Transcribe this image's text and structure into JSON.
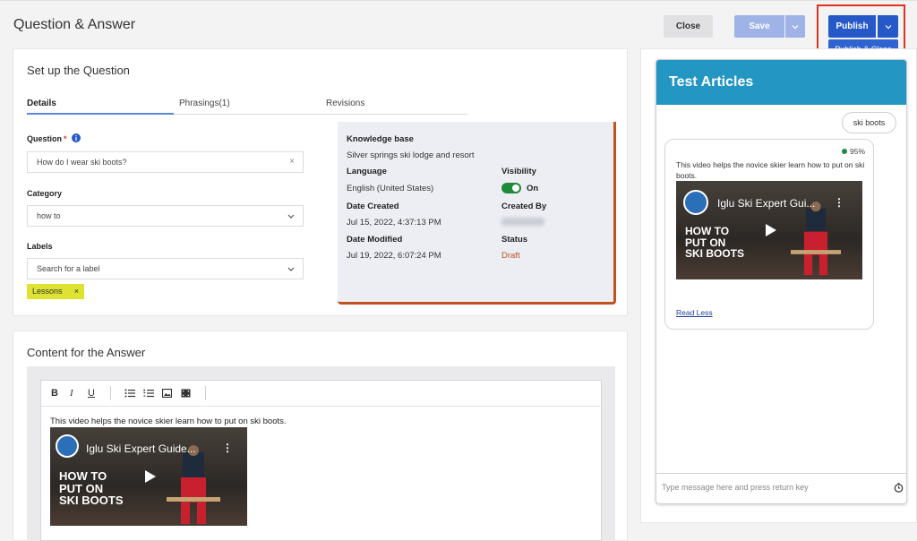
{
  "header": {
    "title": "Question & Answer",
    "close_label": "Close",
    "save_label": "Save",
    "publish_label": "Publish",
    "publish_close_label": "Publish & Close"
  },
  "setup": {
    "title": "Set up the Question",
    "tabs": [
      {
        "label": "Details",
        "active": true
      },
      {
        "label": "Phrasings(1)",
        "active": false
      },
      {
        "label": "Revisions",
        "active": false
      }
    ],
    "question_label": "Question",
    "question_required": "*",
    "question_value": "How do I wear ski boots?",
    "clear_glyph": "×",
    "category_label": "Category",
    "category_value": "how to",
    "labels_label": "Labels",
    "labels_placeholder": "Search for a label",
    "label_chips": [
      {
        "label": "Lessons",
        "remove": "×"
      }
    ]
  },
  "kb": {
    "kb_label": "Knowledge base",
    "kb_value": "Silver springs ski lodge and resort",
    "language_label": "Language",
    "language_value": "English (United States)",
    "visibility_label": "Visibility",
    "visibility_value": "On",
    "date_created_label": "Date Created",
    "date_created_value": "Jul 15, 2022, 4:37:13 PM",
    "created_by_label": "Created By",
    "date_modified_label": "Date Modified",
    "date_modified_value": "Jul 19, 2022, 6:07:24 PM",
    "status_label": "Status",
    "status_value": "Draft"
  },
  "answer": {
    "title": "Content for the Answer",
    "toolbar": {
      "bold": "B",
      "italic": "I",
      "underline": "U"
    },
    "body_text": "This video helps the novice skier learn how to put on ski boots.",
    "video_title": "Iglu Ski Expert Guide...",
    "video_lines": [
      "HOW TO",
      "PUT ON",
      "SKI BOOTS"
    ],
    "video_logo_text": "IGLU SKI",
    "video_menu": "⋮"
  },
  "chat": {
    "title": "Test Articles",
    "user_message": "ski boots",
    "score": "95%",
    "bot_text": "This video helps the novice skier learn how to put on ski boots.",
    "video_title": "Iglu Ski Expert Gui...",
    "video_lines": [
      "HOW TO",
      "PUT ON",
      "SKI BOOTS"
    ],
    "video_logo_text": "IGLU SKI",
    "video_menu": "⋮",
    "read_less": "Read Less",
    "input_placeholder": "Type message here and press return key"
  },
  "colors": {
    "primary": "#2659c7",
    "accent_header": "#2496c4",
    "highlight": "#e0301e",
    "draft": "#c0521e",
    "toggle_on": "#1e8a3a",
    "chip": "#dde330"
  },
  "icons": [
    "info-icon",
    "close-icon",
    "chevron-down-icon",
    "bullet-list-icon",
    "numbered-list-icon",
    "image-icon",
    "video-icon",
    "play-icon",
    "clock-icon"
  ]
}
